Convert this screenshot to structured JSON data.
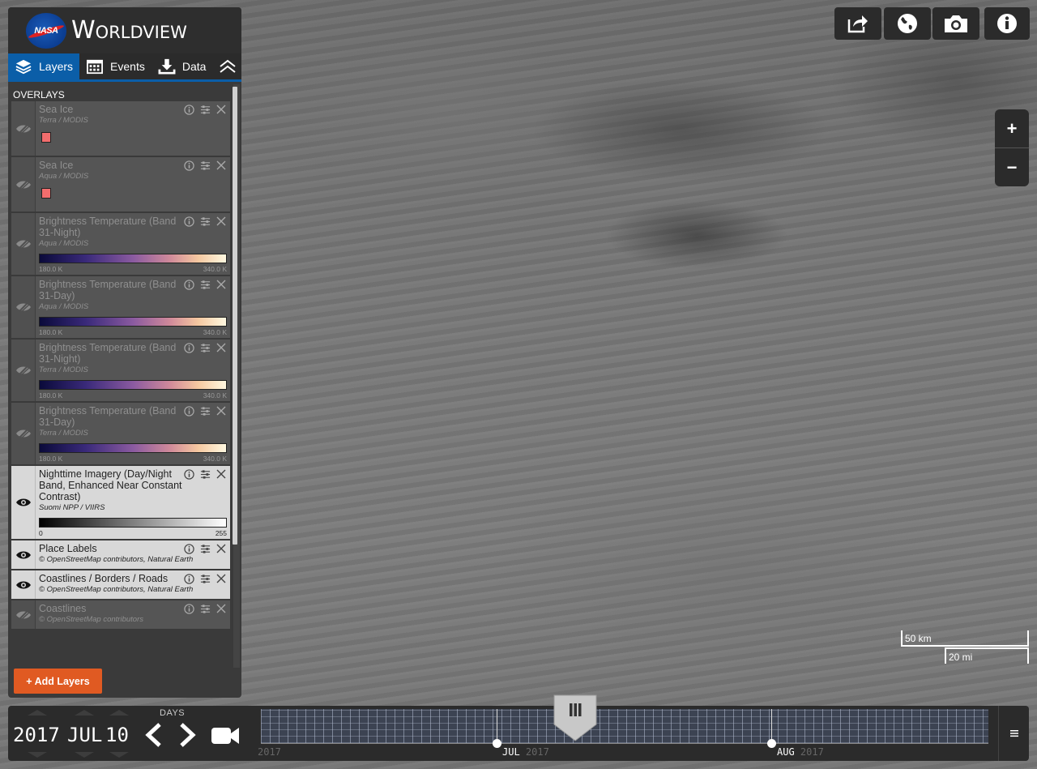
{
  "brand": {
    "logo_text": "NASA",
    "title": "Worldview"
  },
  "tabs": [
    {
      "label": "Layers",
      "icon": "layers-icon",
      "active": true
    },
    {
      "label": "Events",
      "icon": "calendar-icon",
      "active": false
    },
    {
      "label": "Data",
      "icon": "download-icon",
      "active": false
    }
  ],
  "overlays_title": "OVERLAYS",
  "layers": [
    {
      "name": "Sea Ice",
      "source": "Terra / MODIS",
      "visible": false,
      "legend": "swatch"
    },
    {
      "name": "Sea Ice",
      "source": "Aqua / MODIS",
      "visible": false,
      "legend": "swatch"
    },
    {
      "name": "Brightness Temperature (Band 31-Night)",
      "source": "Aqua / MODIS",
      "visible": false,
      "legend": "colorbar",
      "min": "180.0 K",
      "max": "340.0 K"
    },
    {
      "name": "Brightness Temperature (Band 31-Day)",
      "source": "Aqua / MODIS",
      "visible": false,
      "legend": "colorbar",
      "min": "180.0 K",
      "max": "340.0 K"
    },
    {
      "name": "Brightness Temperature (Band 31-Night)",
      "source": "Terra / MODIS",
      "visible": false,
      "legend": "colorbar",
      "min": "180.0 K",
      "max": "340.0 K"
    },
    {
      "name": "Brightness Temperature (Band 31-Day)",
      "source": "Terra / MODIS",
      "visible": false,
      "legend": "colorbar",
      "min": "180.0 K",
      "max": "340.0 K"
    },
    {
      "name": "Nighttime Imagery (Day/Night Band, Enhanced Near Constant Contrast)",
      "source": "Suomi NPP / VIIRS",
      "visible": true,
      "legend": "graybar",
      "min": "0",
      "max": "255"
    },
    {
      "name": "Place Labels",
      "source": "© OpenStreetMap contributors, Natural Earth",
      "visible": true,
      "legend": "none"
    },
    {
      "name": "Coastlines / Borders / Roads",
      "source": "© OpenStreetMap contributors, Natural Earth",
      "visible": true,
      "legend": "none"
    },
    {
      "name": "Coastlines",
      "source": "© OpenStreetMap contributors",
      "visible": false,
      "legend": "none"
    }
  ],
  "add_layers_label": "+ Add Layers",
  "toolbar": [
    "share-icon",
    "globe-projection-icon",
    "camera-snapshot-icon",
    "info-icon"
  ],
  "zoom": {
    "in": "+",
    "out": "−"
  },
  "scale": {
    "km": "50 km",
    "mi": "20 mi"
  },
  "timeline": {
    "year": "2017",
    "month": "JUL",
    "day": "10",
    "interval": "DAYS",
    "months": [
      {
        "label": "JUL",
        "year": "2017"
      },
      {
        "label": "AUG",
        "year": "2017"
      }
    ],
    "left_partial_year": "2017"
  },
  "colors": {
    "accent": "#0b5ea8",
    "add_button": "#e05a22",
    "panel": "#3a3a3a"
  }
}
